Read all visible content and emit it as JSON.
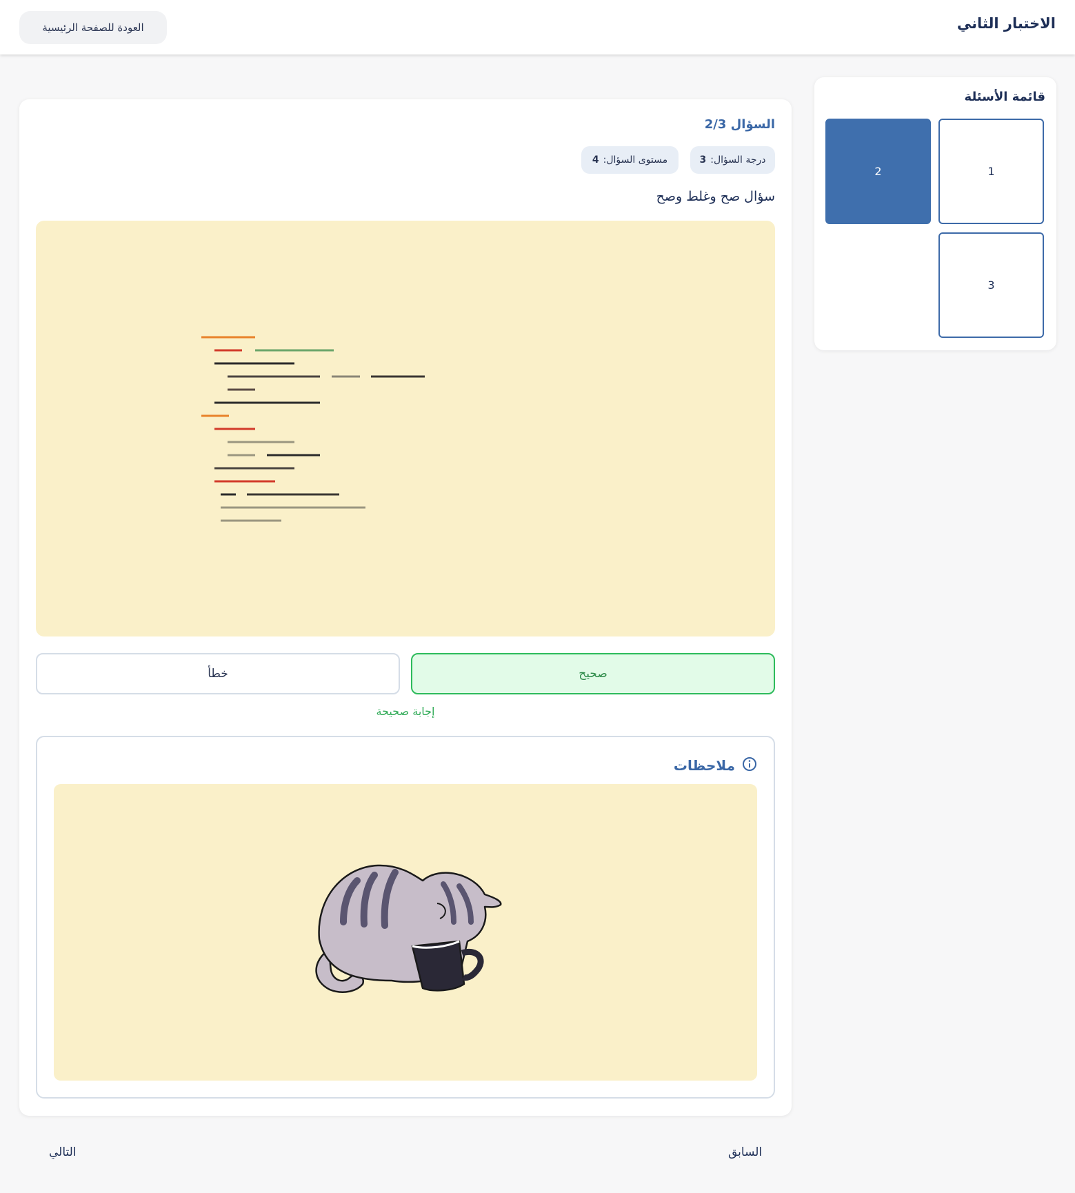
{
  "header": {
    "title": "الاختبار الثاني",
    "back_label": "العودة للصفحة الرئيسية"
  },
  "sidebar": {
    "title": "قائمة الأسئلة",
    "questions": [
      {
        "label": "1",
        "active": false
      },
      {
        "label": "2",
        "active": true
      },
      {
        "label": "3",
        "active": false
      }
    ]
  },
  "question": {
    "number": "السؤال 2/3",
    "score_label": "درجة السؤال:",
    "score_value": "3",
    "level_label": "مستوى السؤال:",
    "level_value": "4",
    "text": "سؤال صح وغلط وصح",
    "image": "code-screenshot-image"
  },
  "answers": {
    "true_label": "صحيح",
    "false_label": "خطأ",
    "result": "إجابة صحيحة"
  },
  "notes": {
    "title": "ملاحظات",
    "icon": "info-icon",
    "image": "cat-in-mug-image"
  },
  "navigation": {
    "prev_label": "السابق",
    "next_label": "التالي"
  },
  "colors": {
    "accent": "#3f6fad",
    "correct": "#2ebb5c",
    "image_bg": "#faf0c9"
  }
}
